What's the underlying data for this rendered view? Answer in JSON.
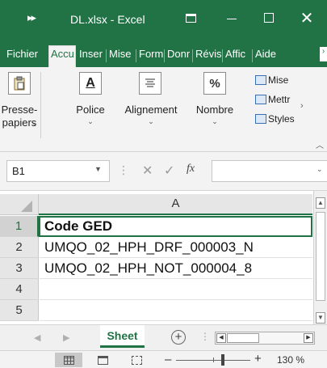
{
  "window": {
    "qat_glyph": "▸▸",
    "title": "DL.xlsx  -  Excel"
  },
  "tabs": [
    "Fichier",
    "Accu",
    "Inser",
    "Mise",
    "Form",
    "Donr",
    "Révis",
    "Affic",
    "Aide"
  ],
  "ribbon": {
    "paste_label_1": "Presse-",
    "paste_label_2": "papiers",
    "font_label": "Police",
    "alignment_label": "Alignement",
    "number_label": "Nombre",
    "number_icon_text": "%",
    "font_icon_text": "A",
    "styles": [
      "Mise",
      "Mettr",
      "Styles"
    ]
  },
  "formula_bar": {
    "name_box": "B1",
    "fx": "fx",
    "value": ""
  },
  "grid": {
    "column_header": "A",
    "rows": [
      {
        "num": "1",
        "value": "Code GED"
      },
      {
        "num": "2",
        "value": "UMQO_02_HPH_DRF_000003_N"
      },
      {
        "num": "3",
        "value": "UMQO_02_HPH_NOT_000004_8"
      },
      {
        "num": "4",
        "value": ""
      },
      {
        "num": "5",
        "value": ""
      }
    ]
  },
  "sheets": {
    "active_sheet": "Sheet",
    "add_glyph": "+"
  },
  "status": {
    "zoom_level": "130 %",
    "zoom_fraction": 0.63
  }
}
